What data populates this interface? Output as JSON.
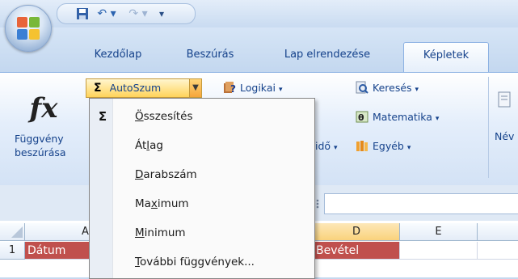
{
  "quick_access": {
    "save_icon": "save-icon",
    "undo_icon": "undo-icon",
    "redo_icon": "redo-icon",
    "customize_icon": "customize-icon"
  },
  "tabs": [
    {
      "label": "Kezdőlap"
    },
    {
      "label": "Beszúrás"
    },
    {
      "label": "Lap elrendezése"
    },
    {
      "label": "Képletek",
      "active": true
    }
  ],
  "ribbon": {
    "insert_function": {
      "line1": "Függvény",
      "line2": "beszúrása"
    },
    "autosum": {
      "symbol": "Σ",
      "label": "AutoSzum"
    },
    "logical": {
      "label": "Logikai"
    },
    "lookup": {
      "label": "Keresés"
    },
    "math": {
      "label": "Matematika"
    },
    "datetime_partial": {
      "label": "idő"
    },
    "more": {
      "label": "Egyéb"
    },
    "name_partial": {
      "label": "Név"
    }
  },
  "autosum_menu": {
    "items": [
      {
        "icon": "Σ",
        "pre": "",
        "ul": "Ö",
        "post": "sszesítés"
      },
      {
        "icon": "",
        "pre": "Át",
        "ul": "l",
        "post": "ag"
      },
      {
        "icon": "",
        "pre": "",
        "ul": "D",
        "post": "arabszám"
      },
      {
        "icon": "",
        "pre": "Ma",
        "ul": "x",
        "post": "imum"
      },
      {
        "icon": "",
        "pre": "",
        "ul": "M",
        "post": "inimum"
      },
      {
        "icon": "",
        "pre": "",
        "ul": "T",
        "post": "ovábbi függvények..."
      }
    ]
  },
  "sheet": {
    "columns": [
      "A",
      "D",
      "E"
    ],
    "row_number": "1",
    "cells": {
      "A1": "Dátum",
      "D1": "Bevétel"
    }
  },
  "colors": {
    "accent_red": "#c0504d",
    "highlight": "#ffd35a"
  }
}
